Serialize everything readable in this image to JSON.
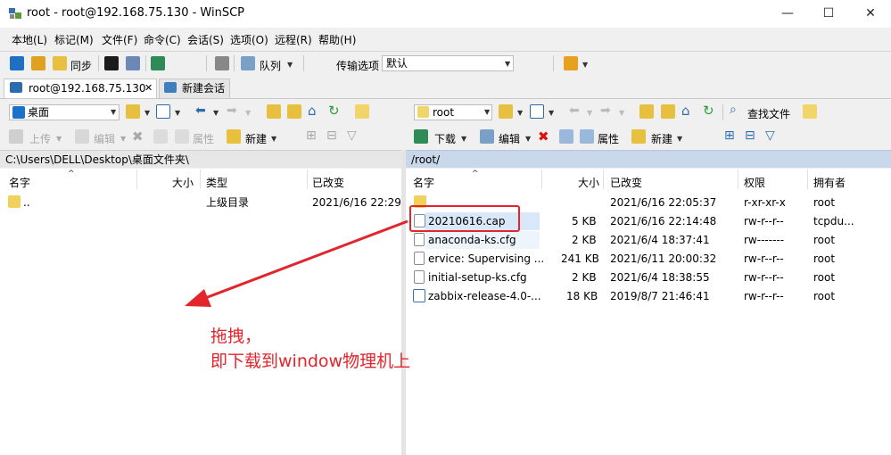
{
  "title": "root - root@192.168.75.130 - WinSCP",
  "window_controls": {
    "minimize": "—",
    "maximize": "☐",
    "close": "✕"
  },
  "menu": [
    "本地(L)",
    "标记(M)",
    "文件(F)",
    "命令(C)",
    "会话(S)",
    "选项(O)",
    "远程(R)",
    "帮助(H)"
  ],
  "toolbar": {
    "sync_label": "同步",
    "queue_label": "队列",
    "transfer_label": "传输选项",
    "transfer_value": "默认"
  },
  "tabs": {
    "session": "root@192.168.75.130",
    "close": "✕",
    "new_session": "新建会话"
  },
  "left": {
    "location": "桌面",
    "upload_label": "上传",
    "edit_label": "编辑",
    "props_label": "属性",
    "new_label": "新建",
    "path": "C:\\Users\\DELL\\Desktop\\桌面文件夹\\",
    "columns": [
      "名字",
      "大小",
      "类型",
      "已改变"
    ],
    "rows": [
      {
        "name": "..",
        "size": "",
        "type": "上级目录",
        "changed": "2021/6/16  22:29"
      }
    ]
  },
  "right": {
    "location": "root",
    "find_label": "查找文件",
    "download_label": "下载",
    "edit_label": "编辑",
    "props_label": "属性",
    "new_label": "新建",
    "path": "/root/",
    "columns": [
      "名字",
      "大小",
      "已改变",
      "权限",
      "拥有者"
    ],
    "rows": [
      {
        "name": "",
        "size": "",
        "changed": "2021/6/16 22:05:37",
        "perm": "r-xr-xr-x",
        "owner": "root"
      },
      {
        "name": "20210616.cap",
        "size": "5 KB",
        "changed": "2021/6/16 22:14:48",
        "perm": "rw-r--r--",
        "owner": "tcpdu..."
      },
      {
        "name": "anaconda-ks.cfg",
        "size": "2 KB",
        "changed": "2021/6/4 18:37:41",
        "perm": "rw-------",
        "owner": "root"
      },
      {
        "name": "ervice: Supervising ...",
        "size": "241 KB",
        "changed": "2021/6/11 20:00:32",
        "perm": "rw-r--r--",
        "owner": "root"
      },
      {
        "name": "initial-setup-ks.cfg",
        "size": "2 KB",
        "changed": "2021/6/4 18:38:55",
        "perm": "rw-r--r--",
        "owner": "root"
      },
      {
        "name": "zabbix-release-4.0-...",
        "size": "18 KB",
        "changed": "2019/8/7 21:46:41",
        "perm": "rw-r--r--",
        "owner": "root"
      }
    ]
  },
  "annotation": {
    "line1": "拖拽，",
    "line2": "即下载到window物理机上"
  },
  "colors": {
    "accent": "#0078d7",
    "annotation": "#e3242b",
    "path_bar": "#c9d7ea"
  }
}
